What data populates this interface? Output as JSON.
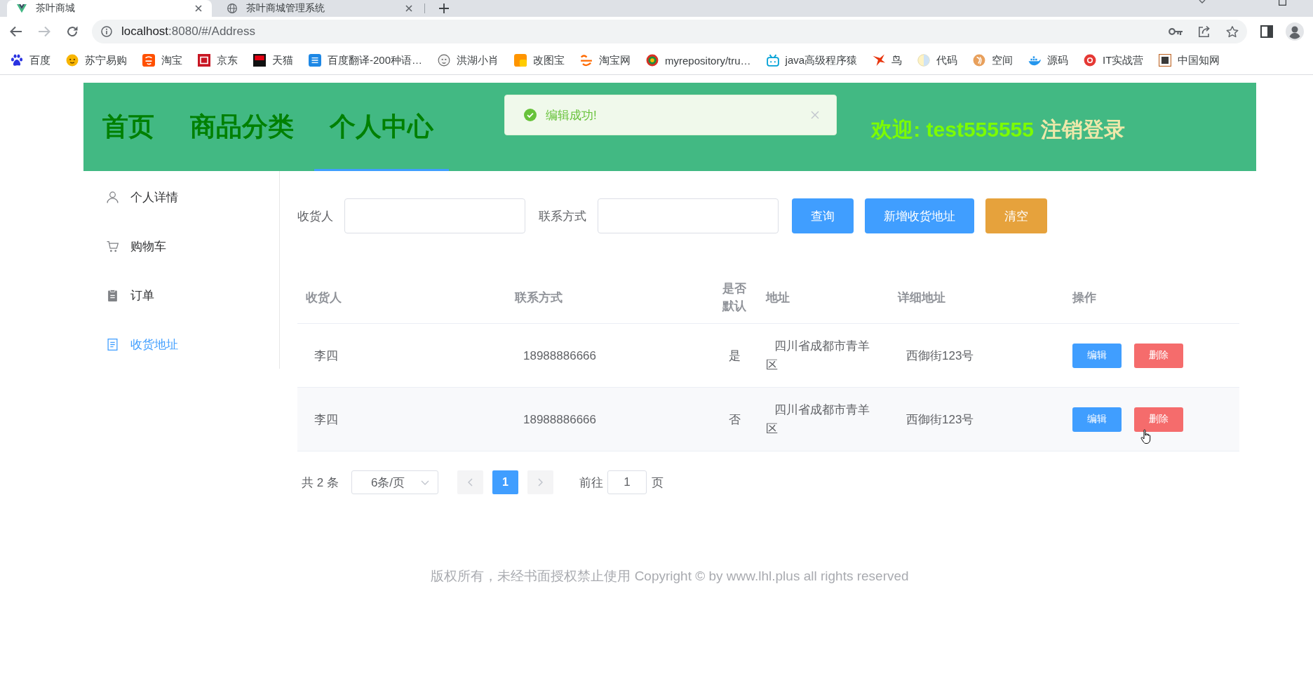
{
  "browser": {
    "tabs": [
      {
        "title": "茶叶商城",
        "selected": true
      },
      {
        "title": "茶叶商城管理系统",
        "selected": false
      }
    ],
    "url": "localhost:8080/#/Address",
    "bookmarks": [
      {
        "label": "百度"
      },
      {
        "label": "苏宁易购"
      },
      {
        "label": "淘宝"
      },
      {
        "label": "京东"
      },
      {
        "label": "天猫"
      },
      {
        "label": "百度翻译-200种语…"
      },
      {
        "label": "洪湖小肖"
      },
      {
        "label": "改图宝"
      },
      {
        "label": "淘宝网"
      },
      {
        "label": "myrepository/tru…"
      },
      {
        "label": "java高级程序猿"
      },
      {
        "label": "鸟"
      },
      {
        "label": "代码"
      },
      {
        "label": "空间"
      },
      {
        "label": "源码"
      },
      {
        "label": "IT实战营"
      },
      {
        "label": "中国知网"
      }
    ]
  },
  "header": {
    "nav": [
      {
        "label": "首页",
        "selected": false
      },
      {
        "label": "商品分类",
        "selected": false
      },
      {
        "label": "个人中心",
        "selected": true
      }
    ],
    "welcome": "欢迎: test555555",
    "logout": "注销登录"
  },
  "toast": {
    "kind": "success",
    "message": "编辑成功!"
  },
  "sidebar": {
    "items": [
      {
        "label": "个人详情",
        "selected": false
      },
      {
        "label": "购物车",
        "selected": false
      },
      {
        "label": "订单",
        "selected": false
      },
      {
        "label": "收货地址",
        "selected": true
      }
    ]
  },
  "search": {
    "fields": [
      {
        "label": "收货人"
      },
      {
        "label": "联系方式"
      }
    ],
    "buttons": [
      {
        "label": "查询",
        "kind": "primary"
      },
      {
        "label": "新增收货地址",
        "kind": "primary"
      },
      {
        "label": "清空",
        "kind": "warning"
      }
    ]
  },
  "table": {
    "columns": [
      "收货人",
      "联系方式",
      "是否默认",
      "地址",
      "详细地址",
      "操作"
    ],
    "rows": [
      {
        "cells": [
          "李四",
          "18988886666",
          "是",
          "四川省成都市青羊区",
          "西御街123号"
        ],
        "actions": [
          {
            "label": "编辑",
            "kind": "primary",
            "hovered": false
          },
          {
            "label": "删除",
            "kind": "danger",
            "hovered": false
          }
        ]
      },
      {
        "cells": [
          "李四",
          "18988886666",
          "否",
          "四川省成都市青羊区",
          "西御街123号"
        ],
        "actions": [
          {
            "label": "编辑",
            "kind": "primary",
            "hovered": false
          },
          {
            "label": "删除",
            "kind": "danger",
            "hovered": true
          }
        ]
      }
    ]
  },
  "pagination": {
    "total": "共 2 条",
    "page_size": "6条/页",
    "prev_disabled": true,
    "pages": [
      {
        "label": "1",
        "selected": true
      }
    ],
    "next_disabled": true,
    "goto_label": "前往",
    "goto_value": "1",
    "goto_suffix": "页"
  },
  "footer": {
    "text": "版权所有，未经书面授权禁止使用 Copyright © by www.lhl.plus all rights reserved"
  }
}
